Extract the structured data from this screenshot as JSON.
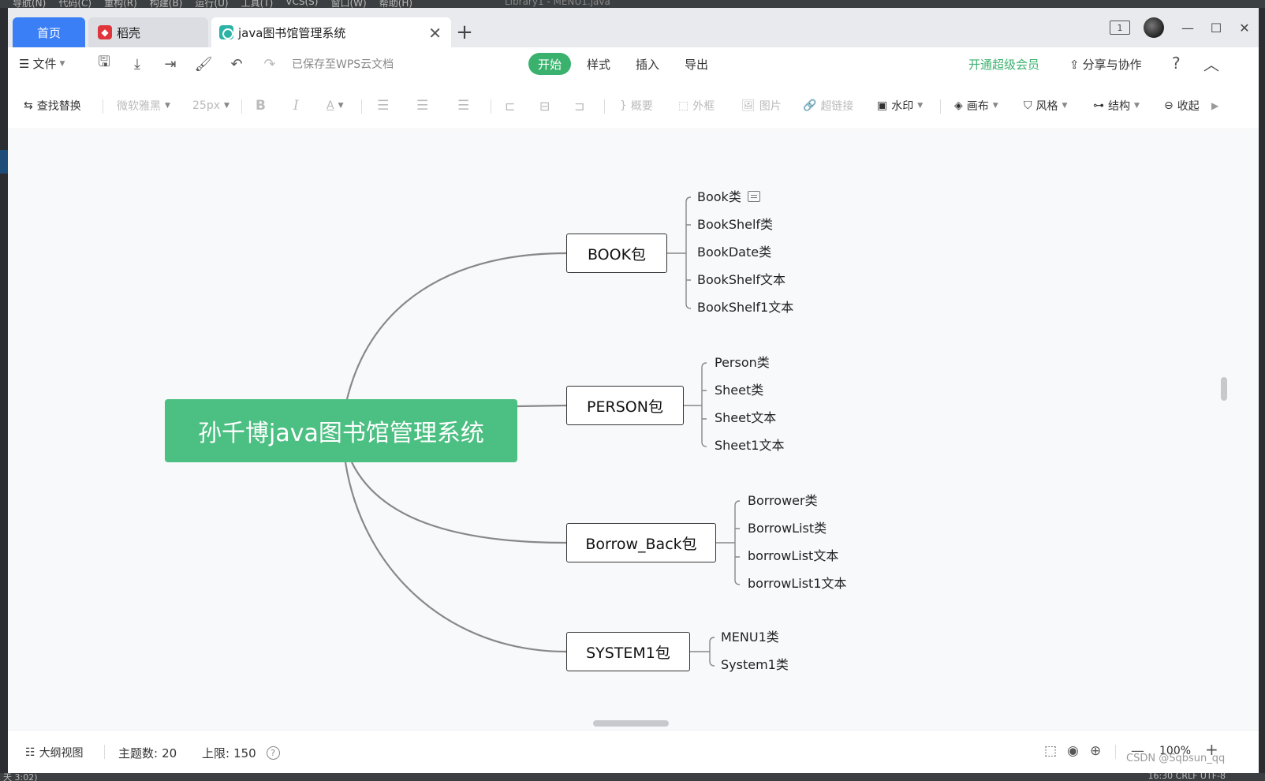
{
  "ide": {
    "menu": [
      "导航(N)",
      "代码(C)",
      "重构(R)",
      "构建(B)",
      "运行(U)",
      "工具(T)",
      "VCS(S)",
      "窗口(W)",
      "帮助(H)"
    ],
    "title": "Library1 - MENU1.java",
    "status_left": "天 3:02)",
    "status_right": "16:30   CRLF   UTF-8"
  },
  "tabs": {
    "home": "首页",
    "daoke": "稻壳",
    "active": "java图书馆管理系统"
  },
  "menubar": {
    "file": "文件",
    "saved": "已保存至WPS云文档",
    "tabs": [
      "开始",
      "样式",
      "插入",
      "导出"
    ],
    "vip": "开通超级会员",
    "share": "分享与协作",
    "help": "?"
  },
  "toolbar": {
    "find_replace": "查找替换",
    "font": "微软雅黑",
    "size": "25px",
    "bold": "B",
    "italic": "I",
    "font_color": "A",
    "summary": "概要",
    "border": "外框",
    "image": "图片",
    "link": "超链接",
    "watermark": "水印",
    "canvas": "画布",
    "style": "风格",
    "structure": "结构",
    "collapse": "收起"
  },
  "mindmap": {
    "root": "孙千博java图书馆管理系统",
    "packages": [
      {
        "label": "BOOK包",
        "children": [
          "Book类",
          "BookShelf类",
          "BookDate类",
          "BookShelf文本",
          "BookShelf1文本"
        ]
      },
      {
        "label": "PERSON包",
        "children": [
          "Person类",
          "Sheet类",
          "Sheet文本",
          "Sheet1文本"
        ]
      },
      {
        "label": "Borrow_Back包",
        "children": [
          "Borrower类",
          "BorrowList类",
          "borrowList文本",
          "borrowList1文本"
        ]
      },
      {
        "label": "SYSTEM1包",
        "children": [
          "MENU1类",
          "System1类"
        ]
      }
    ]
  },
  "statusbar": {
    "outline": "大纲视图",
    "topics_label": "主题数:",
    "topics": "20",
    "limit_label": "上限:",
    "limit": "150",
    "zoom": "100%",
    "watermark": "CSDN @Sqbsun_qq"
  },
  "colors": {
    "root_fill": "#4cbf82",
    "accent_green": "#3ab26e",
    "home_tab": "#3a7ff6",
    "connector": "#888888"
  }
}
